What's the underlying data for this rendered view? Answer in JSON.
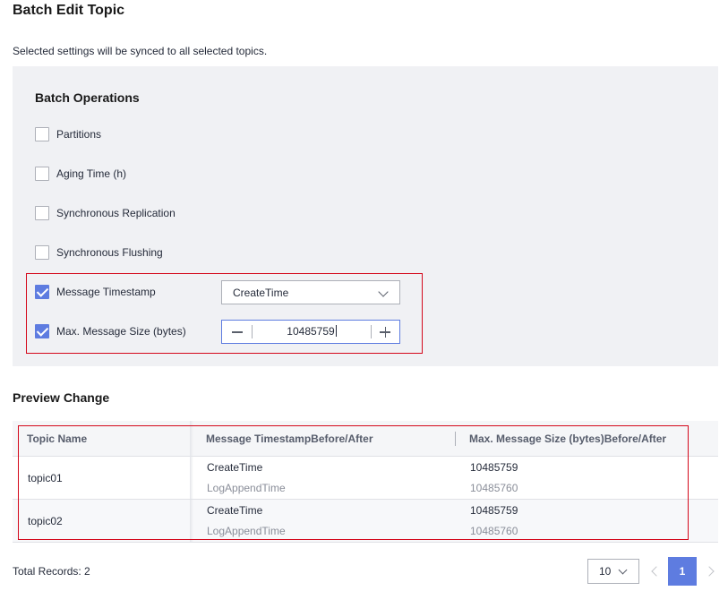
{
  "page": {
    "title": "Batch Edit Topic",
    "subtitle": "Selected settings will be synced to all selected topics."
  },
  "batch": {
    "title": "Batch Operations",
    "operations": [
      {
        "label": "Partitions",
        "checked": false
      },
      {
        "label": "Aging Time (h)",
        "checked": false
      },
      {
        "label": "Synchronous Replication",
        "checked": false
      },
      {
        "label": "Synchronous Flushing",
        "checked": false
      },
      {
        "label": "Message Timestamp",
        "checked": true
      },
      {
        "label": "Max. Message Size (bytes)",
        "checked": true
      }
    ],
    "timestamp_select": {
      "value": "CreateTime"
    },
    "size_stepper": {
      "value": "10485759"
    }
  },
  "preview": {
    "title": "Preview Change",
    "columns": [
      "Topic Name",
      "Message TimestampBefore/After",
      "Max. Message Size (bytes)Before/After"
    ],
    "rows": [
      {
        "name": "topic01",
        "ts_before": "CreateTime",
        "ts_after": "LogAppendTime",
        "size_before": "10485759",
        "size_after": "10485760"
      },
      {
        "name": "topic02",
        "ts_before": "CreateTime",
        "ts_after": "LogAppendTime",
        "size_before": "10485759",
        "size_after": "10485760"
      }
    ]
  },
  "footer": {
    "total": "Total Records: 2",
    "page_size": "10",
    "current_page": "1"
  },
  "colors": {
    "accent": "#5e7ce0",
    "highlight": "#d4081b",
    "panel_bg": "#f0f1f4"
  },
  "icons": [
    "chevron-down-icon",
    "minus-icon",
    "plus-icon",
    "chevron-left-icon",
    "chevron-right-icon",
    "checkmark-icon"
  ]
}
